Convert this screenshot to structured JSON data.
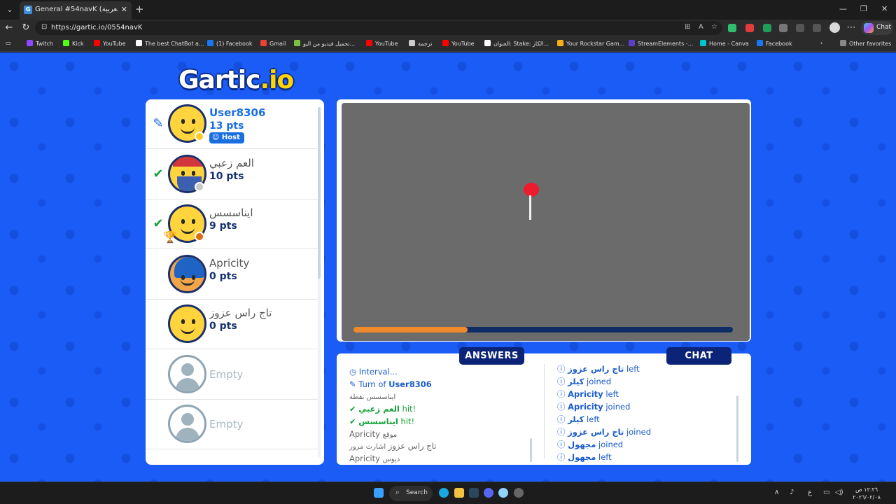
{
  "browser": {
    "tab_title": "General #54navK (العربية) - Gartic.io",
    "url": "https://gartic.io/0554navK",
    "chat_label": "Chat",
    "bookmarks": [
      {
        "label": "Twitch",
        "color": "#9146ff"
      },
      {
        "label": "Kick",
        "color": "#53fc18"
      },
      {
        "label": "YouTube",
        "color": "#ff0000"
      },
      {
        "label": "The best ChatBot a...",
        "color": "#ffffff"
      },
      {
        "label": "(1) Facebook",
        "color": "#1877f2"
      },
      {
        "label": "Gmail",
        "color": "#ea4335"
      },
      {
        "label": "تحميل فيديو من اليو...",
        "color": "#7bc043"
      },
      {
        "label": "YouTube",
        "color": "#ff0000"
      },
      {
        "label": "ترجمة",
        "color": "#cccccc"
      },
      {
        "label": "YouTube",
        "color": "#ff0000"
      },
      {
        "label": "العنوان: Stake: الكاز...",
        "color": "#ffffff"
      },
      {
        "label": "Your Rockstar Gam...",
        "color": "#fcaf17"
      },
      {
        "label": "StreamElements -...",
        "color": "#5a3ec8"
      },
      {
        "label": "Home - Canva",
        "color": "#00c4cc"
      },
      {
        "label": "Facebook",
        "color": "#1877f2"
      }
    ],
    "other_favorites": "Other favorites"
  },
  "game": {
    "logo_main": "Gartic",
    "logo_io": ".io",
    "players": [
      {
        "name": "User8306",
        "pts": "13 pts",
        "host_label": "Host",
        "mark": "pencil",
        "name_color": "#1a6fe0",
        "pts_color": "#1a6fe0",
        "dot": "#ffc928"
      },
      {
        "name": "العم زعبي",
        "pts": "10 pts",
        "mark": "check",
        "name_color": "#555555",
        "pts_color": "#15316f",
        "dot": "#c9c9c9"
      },
      {
        "name": "ايناسسس",
        "pts": "9 pts",
        "mark": "check",
        "name_color": "#555555",
        "pts_color": "#15316f",
        "dot": "#e06c12"
      },
      {
        "name": "Apricity",
        "pts": "0 pts",
        "mark": "",
        "name_color": "#555555",
        "pts_color": "#15316f"
      },
      {
        "name": "تاج راس عزوز",
        "pts": "0 pts",
        "mark": "",
        "name_color": "#555555",
        "pts_color": "#15316f"
      },
      {
        "name": "Empty",
        "empty": true
      },
      {
        "name": "Empty",
        "empty": true
      }
    ],
    "timer_progress": 0.3,
    "tabs": {
      "answers": "ANSWERS",
      "chat": "CHAT"
    },
    "answers": [
      {
        "icon": "clock",
        "text": "Interval..."
      },
      {
        "icon": "pencil",
        "text_prefix": "Turn of",
        "text_name": "User8306"
      },
      {
        "text": "ايناسسس نقطة"
      },
      {
        "icon": "check",
        "name": "العم زعبي",
        "text": "hit!"
      },
      {
        "icon": "check",
        "name": "ايناسسس",
        "text": "hit!"
      },
      {
        "name": "Apricity",
        "text": "موقع"
      },
      {
        "name": "تاج راس عزوز",
        "text": "اشارت مرور"
      },
      {
        "name": "Apricity",
        "text": "ديوس"
      }
    ],
    "chat": [
      {
        "name": "تاج راس عزوز",
        "text": "left"
      },
      {
        "name": "كيلر",
        "text": "joined"
      },
      {
        "name": "Apricity",
        "text": "left"
      },
      {
        "name": "Apricity",
        "text": "joined"
      },
      {
        "name": "كيلر",
        "text": "left"
      },
      {
        "name": "تاج راس عزوز",
        "text": "joined"
      },
      {
        "name": "مجهول",
        "text": "joined"
      },
      {
        "name": "مجهول",
        "text": "left"
      }
    ]
  },
  "taskbar": {
    "search_label": "Search",
    "lang": "ع",
    "time": "١٢:٢٦ ص",
    "date": "٢٠٢٦/٠٢/٠٨"
  }
}
